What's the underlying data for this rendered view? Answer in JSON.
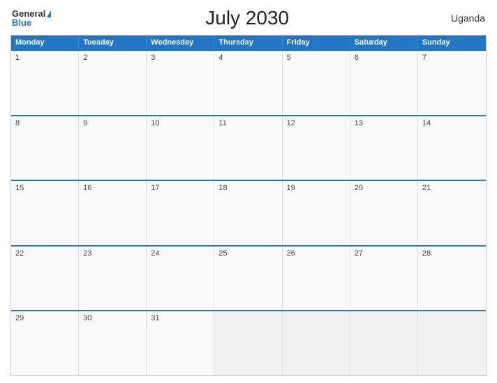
{
  "header": {
    "logo_general": "General",
    "logo_blue": "Blue",
    "title": "July 2030",
    "country": "Uganda"
  },
  "calendar": {
    "days_of_week": [
      "Monday",
      "Tuesday",
      "Wednesday",
      "Thursday",
      "Friday",
      "Saturday",
      "Sunday"
    ],
    "weeks": [
      [
        {
          "day": "1",
          "empty": false
        },
        {
          "day": "2",
          "empty": false
        },
        {
          "day": "3",
          "empty": false
        },
        {
          "day": "4",
          "empty": false
        },
        {
          "day": "5",
          "empty": false
        },
        {
          "day": "6",
          "empty": false
        },
        {
          "day": "7",
          "empty": false
        }
      ],
      [
        {
          "day": "8",
          "empty": false
        },
        {
          "day": "9",
          "empty": false
        },
        {
          "day": "10",
          "empty": false
        },
        {
          "day": "11",
          "empty": false
        },
        {
          "day": "12",
          "empty": false
        },
        {
          "day": "13",
          "empty": false
        },
        {
          "day": "14",
          "empty": false
        }
      ],
      [
        {
          "day": "15",
          "empty": false
        },
        {
          "day": "16",
          "empty": false
        },
        {
          "day": "17",
          "empty": false
        },
        {
          "day": "18",
          "empty": false
        },
        {
          "day": "19",
          "empty": false
        },
        {
          "day": "20",
          "empty": false
        },
        {
          "day": "21",
          "empty": false
        }
      ],
      [
        {
          "day": "22",
          "empty": false
        },
        {
          "day": "23",
          "empty": false
        },
        {
          "day": "24",
          "empty": false
        },
        {
          "day": "25",
          "empty": false
        },
        {
          "day": "26",
          "empty": false
        },
        {
          "day": "27",
          "empty": false
        },
        {
          "day": "28",
          "empty": false
        }
      ],
      [
        {
          "day": "29",
          "empty": false
        },
        {
          "day": "30",
          "empty": false
        },
        {
          "day": "31",
          "empty": false
        },
        {
          "day": "",
          "empty": true
        },
        {
          "day": "",
          "empty": true
        },
        {
          "day": "",
          "empty": true
        },
        {
          "day": "",
          "empty": true
        }
      ]
    ]
  }
}
